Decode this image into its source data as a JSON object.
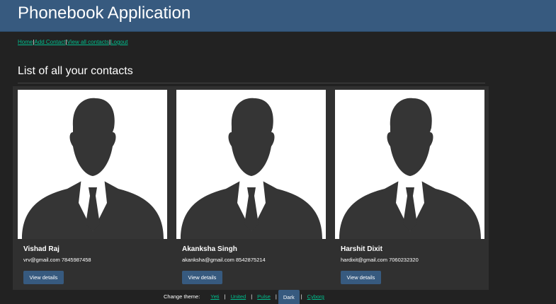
{
  "app": {
    "title": "Phonebook Application"
  },
  "nav": {
    "items": [
      {
        "label": "Home"
      },
      {
        "label": "Add Contact"
      },
      {
        "label": "View all contacts"
      },
      {
        "label": "Logout"
      }
    ],
    "separator": "|"
  },
  "main": {
    "heading": "List of all your contacts"
  },
  "contacts": [
    {
      "name": "Vishad Raj",
      "email": "vrv@gmail.com",
      "phone": "7845987458",
      "button_label": "View details",
      "avatar_icon": "person-silhouette-icon"
    },
    {
      "name": "Akanksha Singh",
      "email": "akanksha@gmail.com",
      "phone": "8542875214",
      "button_label": "View details",
      "avatar_icon": "person-silhouette-icon"
    },
    {
      "name": "Harshit Dixit",
      "email": "hardixit@gmail.com",
      "phone": "7060232320",
      "button_label": "View details",
      "avatar_icon": "person-silhouette-icon"
    }
  ],
  "theme": {
    "label": "Change theme:",
    "options": [
      "Yeti",
      "United",
      "Pulse",
      "Dark",
      "Cyborg"
    ],
    "selected": "Dark"
  },
  "colors": {
    "background": "#222222",
    "header": "#375a7f",
    "link": "#00bc8c",
    "card": "#303030",
    "button": "#375a7f"
  }
}
